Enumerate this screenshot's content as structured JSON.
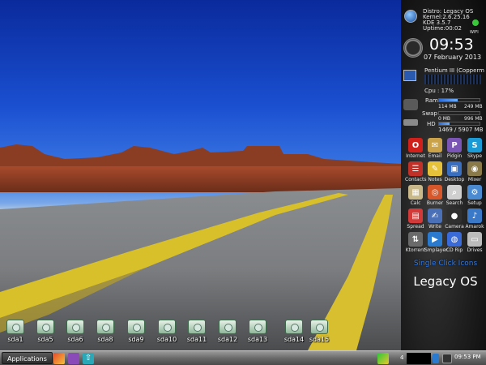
{
  "sysinfo": {
    "distro": "Distro: Legacy OS",
    "kernel": "Kernel:2.6.25.16",
    "kde": "KDE   3.5.7",
    "uptime": "Uptime:00:02",
    "wifi_label": "WIFI"
  },
  "clock": {
    "time": "09:53",
    "date": "07 February 2013"
  },
  "cpu": {
    "name": "Pentium III (Copperm",
    "usage_label": "Cpu : 17%"
  },
  "ram": {
    "label": "Ram",
    "used": "114 MB",
    "total": "249 MB",
    "fraction": 0.46
  },
  "swap": {
    "label": "Swap",
    "used": "0 MB",
    "total": "996 MB",
    "fraction": 0.0
  },
  "hd": {
    "label": "HD",
    "summary": "1469 / 5907 MB",
    "fraction": 0.25
  },
  "apps": [
    {
      "label": "Internet",
      "icon": "opera-icon",
      "color": "#d0201c",
      "glyph": "O"
    },
    {
      "label": "Email",
      "icon": "mail-icon",
      "color": "#c9a24a",
      "glyph": "✉"
    },
    {
      "label": "Pidgin",
      "icon": "pidgin-icon",
      "color": "#7a55b3",
      "glyph": "P"
    },
    {
      "label": "Skype",
      "icon": "skype-icon",
      "color": "#1b9ad6",
      "glyph": "S"
    },
    {
      "label": "Contacts",
      "icon": "contacts-icon",
      "color": "#c0312a",
      "glyph": "☰"
    },
    {
      "label": "Notes",
      "icon": "notes-icon",
      "color": "#e6c23a",
      "glyph": "✎"
    },
    {
      "label": "Desktop",
      "icon": "desktop-icon",
      "color": "#3a6fc0",
      "glyph": "▣"
    },
    {
      "label": "Mixer",
      "icon": "mixer-icon",
      "color": "#8a7a4a",
      "glyph": "◉"
    },
    {
      "label": "Calc",
      "icon": "calculator-icon",
      "color": "#c8b88a",
      "glyph": "▦"
    },
    {
      "label": "Burner",
      "icon": "burner-icon",
      "color": "#d8572a",
      "glyph": "◎"
    },
    {
      "label": "Search",
      "icon": "search-icon",
      "color": "#cfcfcf",
      "glyph": "⌕"
    },
    {
      "label": "Setup",
      "icon": "setup-icon",
      "color": "#4a8ad0",
      "glyph": "⚙"
    },
    {
      "label": "Spread",
      "icon": "spreadsheet-icon",
      "color": "#d23a3a",
      "glyph": "▤"
    },
    {
      "label": "Write",
      "icon": "write-icon",
      "color": "#4a70b8",
      "glyph": "✍"
    },
    {
      "label": "Camera",
      "icon": "camera-icon",
      "color": "#303030",
      "glyph": "●"
    },
    {
      "label": "Amarok",
      "icon": "amarok-icon",
      "color": "#3a78c8",
      "glyph": "♪"
    },
    {
      "label": "Ktorrent",
      "icon": "ktorrent-icon",
      "color": "#6a6a6a",
      "glyph": "⇅"
    },
    {
      "label": "Smplayer",
      "icon": "smplayer-icon",
      "color": "#2a7ad0",
      "glyph": "▶"
    },
    {
      "label": "CD Rip",
      "icon": "cd-rip-icon",
      "color": "#3a6ad8",
      "glyph": "◍"
    },
    {
      "label": "Drives",
      "icon": "drives-icon",
      "color": "#bcbcbc",
      "glyph": "▭"
    }
  ],
  "single_click": "Single Click Icons",
  "os_title": "Legacy OS",
  "drives": [
    "sda1",
    "sda5",
    "sda6",
    "sda8",
    "sda9",
    "sda10",
    "sda11",
    "sda12",
    "sda13",
    "sda14",
    "sda15"
  ],
  "taskbar": {
    "applications": "Applications",
    "tray_num": "4",
    "time": "09:53 PM"
  }
}
